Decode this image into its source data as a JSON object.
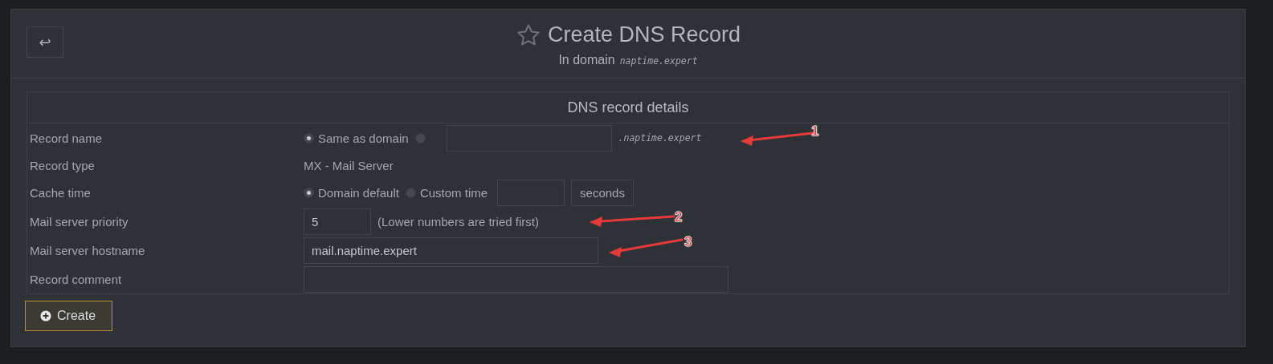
{
  "back_button": {
    "symbol": "↩"
  },
  "header": {
    "starred": false,
    "title": "Create DNS Record",
    "subtitle": "In domain",
    "domain": "naptime.expert"
  },
  "section": {
    "title": "DNS record details",
    "rows": [
      {
        "kind": "record-name",
        "label": "Record name",
        "options": [
          {
            "label": "Same as domain",
            "selected": true
          },
          {
            "selected": false
          }
        ],
        "suffix": ".naptime.expert"
      },
      {
        "kind": "text",
        "label": "Record type",
        "value": "MX - Mail Server"
      },
      {
        "kind": "cache-time",
        "label": "Cache time",
        "options": [
          {
            "label": "Domain default",
            "selected": true
          },
          {
            "label": "Custom time",
            "selected": false
          }
        ],
        "unit": "seconds"
      },
      {
        "kind": "number",
        "label": "Mail server priority",
        "value": "5",
        "note": "(Lower numbers are tried first)"
      },
      {
        "kind": "input",
        "label": "Mail server hostname",
        "value": "mail.naptime.expert"
      },
      {
        "kind": "comment",
        "label": "Record comment"
      }
    ]
  },
  "create_button": {
    "label": "Create"
  },
  "annotations": [
    {
      "label": "1"
    },
    {
      "label": "2"
    },
    {
      "label": "3"
    }
  ]
}
